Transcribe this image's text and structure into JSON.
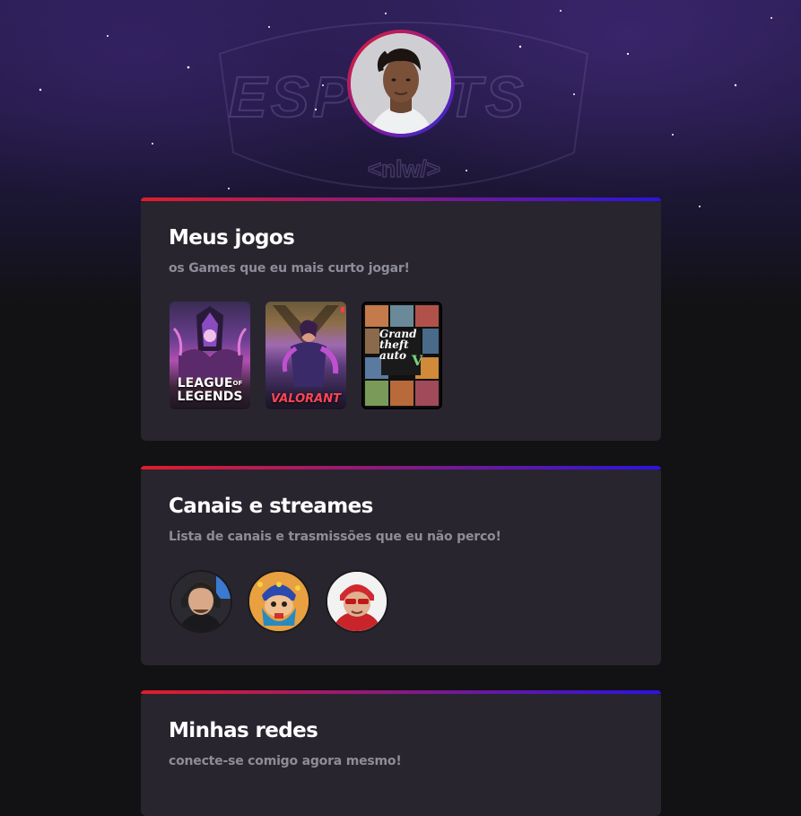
{
  "background": {
    "logo_text": "ESPORTS",
    "logo_sub": "<nlw/>"
  },
  "profile": {
    "avatar_icon": "profile-photo"
  },
  "sections": [
    {
      "title": "Meus jogos",
      "subtitle": "os Games que eu mais curto jogar!",
      "games": [
        {
          "name": "League of Legends",
          "caption_line1": "LEAGUE",
          "caption_of": "OF",
          "caption_line2": "LEGENDS"
        },
        {
          "name": "Valorant",
          "caption": "VALORANT"
        },
        {
          "name": "Grand Theft Auto V",
          "caption_line1": "Grand",
          "caption_line2": "theft",
          "caption_line3": "auto",
          "caption_v": "V"
        }
      ]
    },
    {
      "title": "Canais e streames",
      "subtitle": "Lista de canais e trasmissões que eu não perco!",
      "streamers": [
        {
          "icon": "streamer-avatar-1"
        },
        {
          "icon": "streamer-avatar-2"
        },
        {
          "icon": "streamer-avatar-3"
        }
      ]
    },
    {
      "title": "Minhas redes",
      "subtitle": "conecte-se comigo agora mesmo!"
    }
  ],
  "colors": {
    "accent_red": "#e11d2a",
    "accent_blue": "#2a14e0",
    "card_bg": "#29252f",
    "page_bg": "#121214"
  }
}
